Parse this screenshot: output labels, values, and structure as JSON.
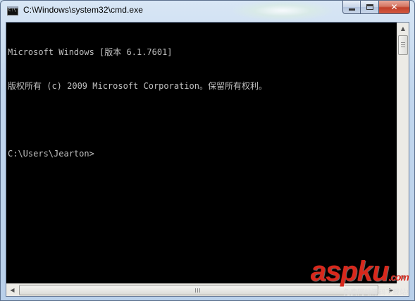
{
  "window": {
    "title": "C:\\Windows\\system32\\cmd.exe",
    "icon": "cmd-icon",
    "buttons": {
      "minimize": "minimize-icon",
      "maximize": "maximize-icon",
      "close": "✕"
    }
  },
  "console": {
    "lines": [
      "Microsoft Windows [版本 6.1.7601]",
      "版权所有 (c) 2009 Microsoft Corporation。保留所有权利。",
      "",
      "C:\\Users\\Jearton>"
    ],
    "background": "#000000",
    "foreground": "#c0c0c0"
  },
  "watermark": {
    "brand": "aspku",
    "dot": ".com",
    "sub": "免费网站源码下载站!"
  }
}
